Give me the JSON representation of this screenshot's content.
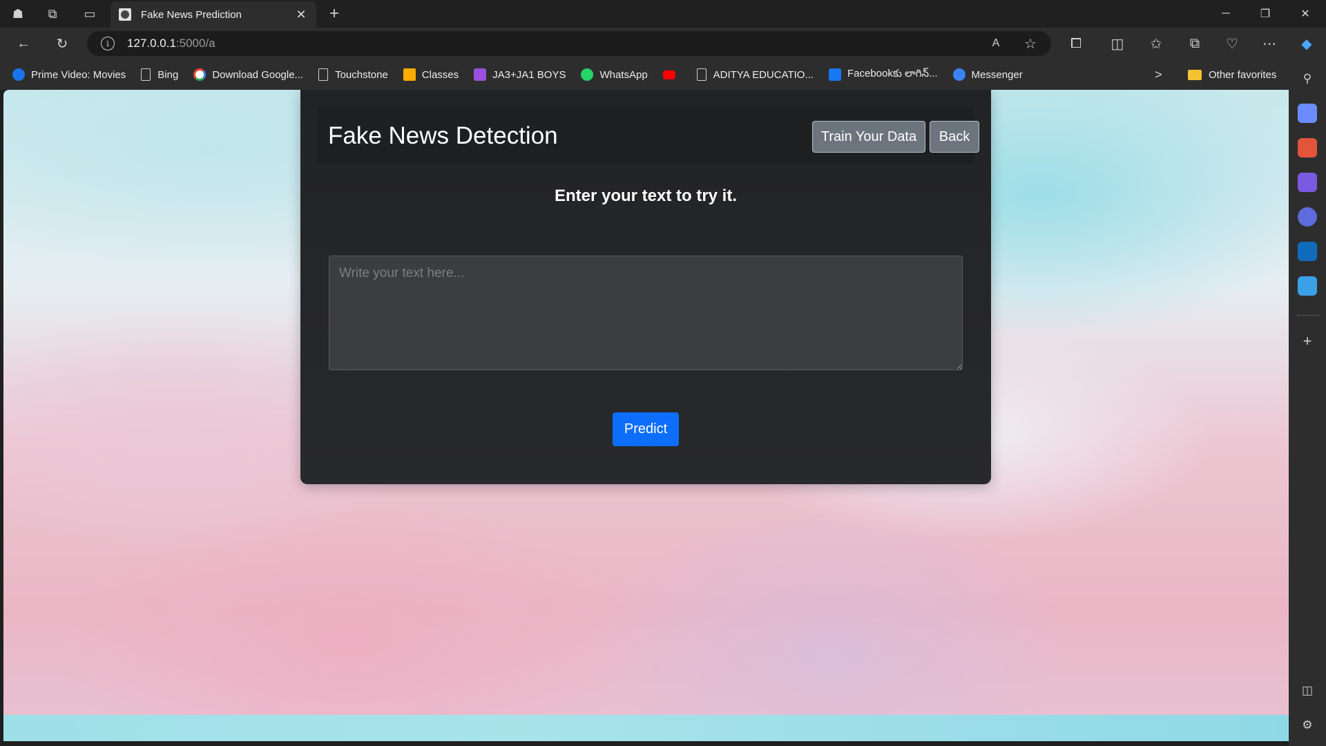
{
  "browser": {
    "tab": {
      "title": "Fake News Prediction",
      "close": "✕"
    },
    "new_tab": "+",
    "window_controls": {
      "minimize": "─",
      "restore": "❐",
      "close": "✕"
    },
    "url": {
      "host": "127.0.0.1",
      "path": ":5000/a"
    },
    "bookmarks": [
      {
        "label": "Prime Video: Movies",
        "icon": "prime-video-icon",
        "color": "#1a73e8"
      },
      {
        "label": "Bing",
        "icon": "document-icon"
      },
      {
        "label": "Download Google...",
        "icon": "google-icon",
        "color": "#ffffff"
      },
      {
        "label": "Touchstone",
        "icon": "document-icon"
      },
      {
        "label": "Classes",
        "icon": "google-classroom-icon",
        "color": "#f9ab00"
      },
      {
        "label": "JA3+JA1 BOYS",
        "icon": "group-icon",
        "color": "#9b51e0"
      },
      {
        "label": "WhatsApp",
        "icon": "whatsapp-icon",
        "color": "#25d366"
      },
      {
        "label": "",
        "icon": "youtube-icon",
        "color": "#ff0000"
      },
      {
        "label": "ADITYA EDUCATIO...",
        "icon": "document-icon"
      },
      {
        "label": "Facebookకు లాగిన్...",
        "icon": "facebook-icon",
        "color": "#1877f2"
      },
      {
        "label": "Messenger",
        "icon": "messenger-icon",
        "color": "#3b82f6"
      }
    ],
    "bookmarks_overflow": ">",
    "other_favorites": "Other favorites"
  },
  "app": {
    "title": "Fake News Detection",
    "train_button": "Train Your Data",
    "back_button": "Back",
    "prompt": "Enter your text to try it.",
    "input_placeholder": "Write your text here...",
    "input_value": "",
    "predict_button": "Predict",
    "colors": {
      "primary": "#0d6efd",
      "secondary": "#6c757d",
      "card": "#252628"
    }
  }
}
